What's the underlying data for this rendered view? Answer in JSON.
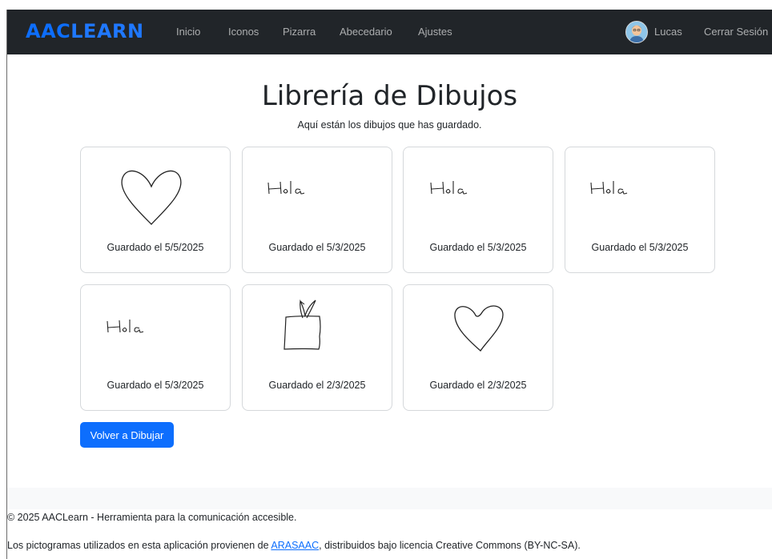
{
  "navbar": {
    "brand_part1": "AAC",
    "brand_part2": "LEARN",
    "links": [
      "Inicio",
      "Iconos",
      "Pizarra",
      "Abecedario",
      "Ajustes"
    ],
    "user_name": "Lucas",
    "logout_label": "Cerrar Sesión"
  },
  "page": {
    "title": "Librería de Dibujos",
    "subtitle": "Aquí están los dibujos que has guardado."
  },
  "drawings": [
    {
      "caption": "Guardado el 5/5/2025",
      "icon": "heart-drawing"
    },
    {
      "caption": "Guardado el 5/3/2025",
      "icon": "hola-drawing"
    },
    {
      "caption": "Guardado el 5/3/2025",
      "icon": "hola-drawing"
    },
    {
      "caption": "Guardado el 5/3/2025",
      "icon": "hola-drawing"
    },
    {
      "caption": "Guardado el 5/3/2025",
      "icon": "hola-drawing"
    },
    {
      "caption": "Guardado el 2/3/2025",
      "icon": "box-drawing"
    },
    {
      "caption": "Guardado el 2/3/2025",
      "icon": "heart-drawing"
    }
  ],
  "actions": {
    "redraw_label": "Volver a Dibujar"
  },
  "footer": {
    "copyright": "© 2025 AACLearn - Herramienta para la comunicación accesible.",
    "credits_prefix": "Los pictogramas utilizados en esta aplicación provienen de ",
    "credits_link": "ARASAAC",
    "credits_suffix": ", distribuidos bajo licencia Creative Commons (BY-NC-SA)."
  },
  "colors": {
    "navbar_bg": "#212529",
    "primary": "#0d6efd"
  }
}
